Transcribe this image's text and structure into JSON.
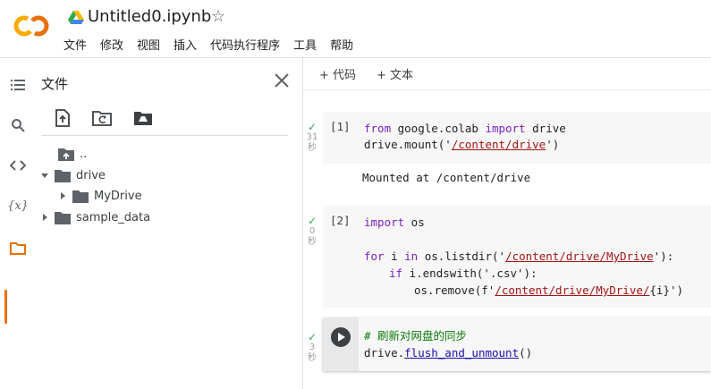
{
  "header": {
    "logo": {
      "icon": "colab-logo",
      "text": "CO",
      "color_left": "#f9ab00",
      "color_right": "#e8710a"
    },
    "drive_icon": "google-drive-icon",
    "notebook_title": "Untitled0.ipynb",
    "star_icon": "☆",
    "menu": [
      "文件",
      "修改",
      "视图",
      "插入",
      "代码执行程序",
      "工具",
      "帮助"
    ]
  },
  "rail": {
    "items": [
      {
        "name": "table-of-contents",
        "icon": "list-icon"
      },
      {
        "name": "search",
        "icon": "search-icon"
      },
      {
        "name": "code-snippets",
        "icon": "code-icon"
      },
      {
        "name": "variables",
        "icon": "variables-icon",
        "glyph": "{x}"
      },
      {
        "name": "files",
        "icon": "folder-icon",
        "active": true
      }
    ],
    "active_color": "#e8710a"
  },
  "files_panel": {
    "title": "文件",
    "close_icon": "close-icon",
    "tools": [
      "upload-file-icon",
      "refresh-folder-icon",
      "mount-drive-icon"
    ],
    "tree": [
      {
        "label": "..",
        "type": "parent"
      },
      {
        "label": "drive",
        "type": "folder",
        "expanded": true
      },
      {
        "label": "MyDrive",
        "type": "folder",
        "expanded": false
      },
      {
        "label": "sample_data",
        "type": "folder",
        "expanded": false
      }
    ]
  },
  "notebook": {
    "add_code": "+ 代码",
    "add_text": "+ 文本",
    "cells": [
      {
        "status": "✓",
        "duration": "31",
        "unit": "秒",
        "count": "[1]",
        "code_l1": {
          "k1": "from",
          "t1": " google.colab ",
          "k2": "import",
          "t2": " drive"
        },
        "code_l2": {
          "t1": "drive.mount('",
          "s1": "/content/drive",
          "t2": "')"
        },
        "output": "Mounted at /content/drive"
      },
      {
        "status": "✓",
        "duration": "0",
        "unit": "秒",
        "count": "[2]",
        "code_l1": {
          "k1": "import",
          "t1": " os"
        },
        "code_l2": {
          "k1": "for",
          "t1": " i ",
          "k2": "in",
          "t2": " os.listdir('",
          "s1": "/content/drive/MyDrive",
          "t3": "'):"
        },
        "code_l3": {
          "k1": "if",
          "t1": " i.endswith('.csv'):"
        },
        "code_l4": {
          "t1": "os.remove(f'",
          "s1": "/content/drive/MyDrive/",
          "t2": "{i}')"
        }
      },
      {
        "status": "✓",
        "duration": "3",
        "unit": "秒",
        "code_l1": {
          "c1": "# 刷新对网盘的同步"
        },
        "code_l2": {
          "t1": "drive.",
          "f1": "flush_and_unmount",
          "t2": "()"
        }
      }
    ]
  }
}
